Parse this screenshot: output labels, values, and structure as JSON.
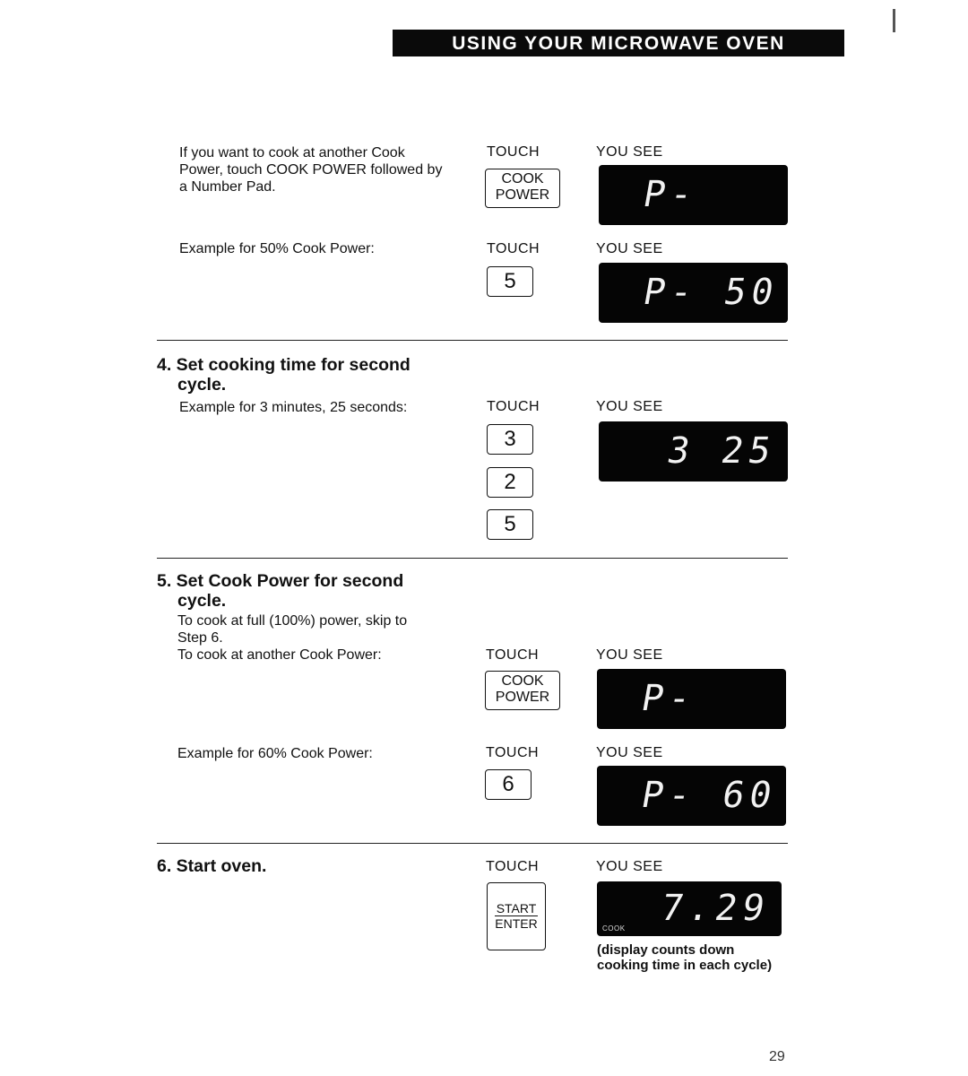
{
  "header": {
    "title": "USING YOUR MICROWAVE OVEN"
  },
  "intro": {
    "text_lines": [
      "If you want to cook at another Cook",
      "Power, touch COOK POWER followed by",
      "a Number Pad."
    ],
    "touch_label": "TOUCH",
    "you_see_label": "YOU SEE",
    "key": {
      "line1": "COOK",
      "line2": "POWER"
    },
    "display": "P-"
  },
  "example50": {
    "text": "Example for 50% Cook Power:",
    "touch_label": "TOUCH",
    "you_see_label": "YOU SEE",
    "key": "5",
    "display": "P- 50"
  },
  "step4": {
    "heading_line1": "4. Set cooking time for second",
    "heading_line2": "cycle.",
    "text": "Example for 3 minutes, 25 seconds:",
    "touch_label": "TOUCH",
    "you_see_label": "YOU SEE",
    "keys": [
      "3",
      "2",
      "5"
    ],
    "display": "3 25"
  },
  "step5": {
    "heading_line1": "5. Set Cook Power for second",
    "heading_line2": "cycle.",
    "text_lines": [
      "To cook at full (100%) power, skip to",
      "Step 6.",
      "To cook at another Cook Power:"
    ],
    "touch_label": "TOUCH",
    "you_see_label": "YOU SEE",
    "key": {
      "line1": "COOK",
      "line2": "POWER"
    },
    "display": "P-",
    "example_text": "Example for 60% Cook Power:",
    "example_touch_label": "TOUCH",
    "example_you_see_label": "YOU SEE",
    "example_key": "6",
    "example_display": "P- 60"
  },
  "step6": {
    "heading": "6. Start oven.",
    "touch_label": "TOUCH",
    "you_see_label": "YOU SEE",
    "key": {
      "line1": "START",
      "line2": "ENTER"
    },
    "display": "7.29",
    "display_indicator": "COOK",
    "note_lines": [
      "(display counts down",
      "cooking time in each cycle)"
    ]
  },
  "footer": {
    "page_number": "29"
  }
}
